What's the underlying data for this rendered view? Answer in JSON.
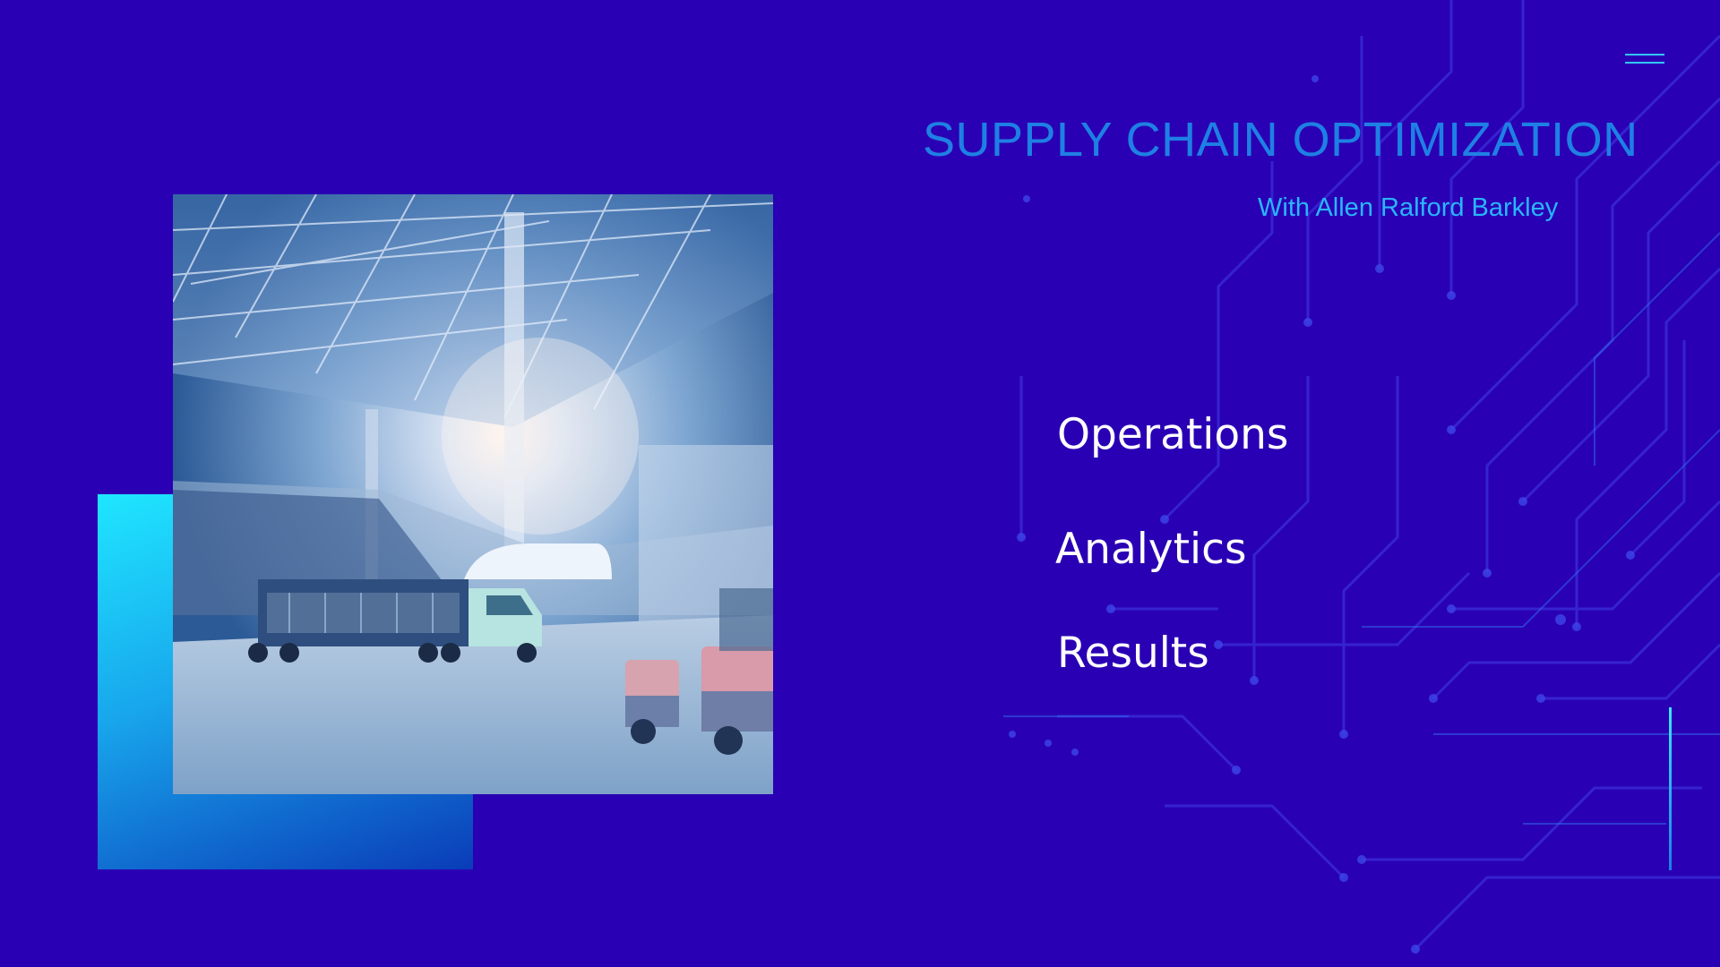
{
  "slide": {
    "title": "SUPPLY CHAIN OPTIMIZATION",
    "subtitle": "With Allen Ralford Barkley",
    "menu_items": [
      "Operations",
      "Analytics",
      "Results"
    ],
    "menu_icon": "hamburger-menu-icon",
    "photo_description_icon": "warehouse-photo",
    "colors": {
      "background": "#2a00b4",
      "title": "#1e80e4",
      "subtitle": "#29b6ff",
      "accent": "#1fe6ff",
      "menu_text": "#ffffff"
    }
  }
}
